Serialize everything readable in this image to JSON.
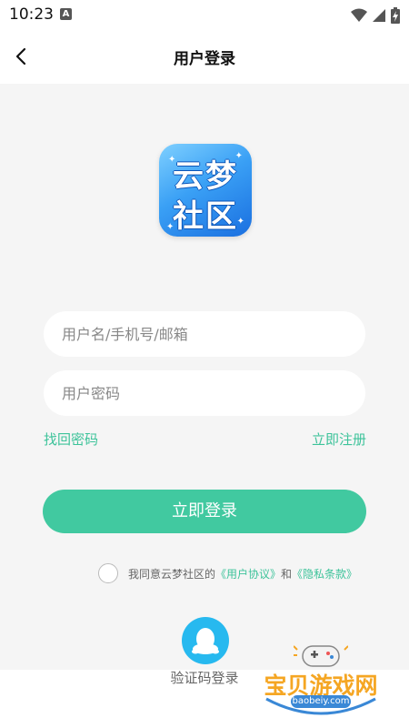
{
  "status_bar": {
    "time": "10:23",
    "notification_letter": "A"
  },
  "header": {
    "title": "用户登录"
  },
  "logo": {
    "line1": "云梦",
    "line2": "社区"
  },
  "form": {
    "username_placeholder": "用户名/手机号/邮箱",
    "password_placeholder": "用户密码",
    "forgot_password": "找回密码",
    "register": "立即注册",
    "login_button": "立即登录"
  },
  "agreement": {
    "prefix": "我同意云梦社区的",
    "user_agreement": "《用户协议》",
    "conjunction": "和",
    "privacy_policy": "《隐私条款》"
  },
  "alt_login": {
    "label": "验证码登录"
  },
  "watermark": {
    "brand": "宝贝游戏网",
    "url": "baobeiy.com"
  },
  "colors": {
    "accent": "#41c9a0",
    "link": "#3dc39a",
    "sms_icon": "#27b9ef",
    "logo": "#3aa0f5"
  }
}
